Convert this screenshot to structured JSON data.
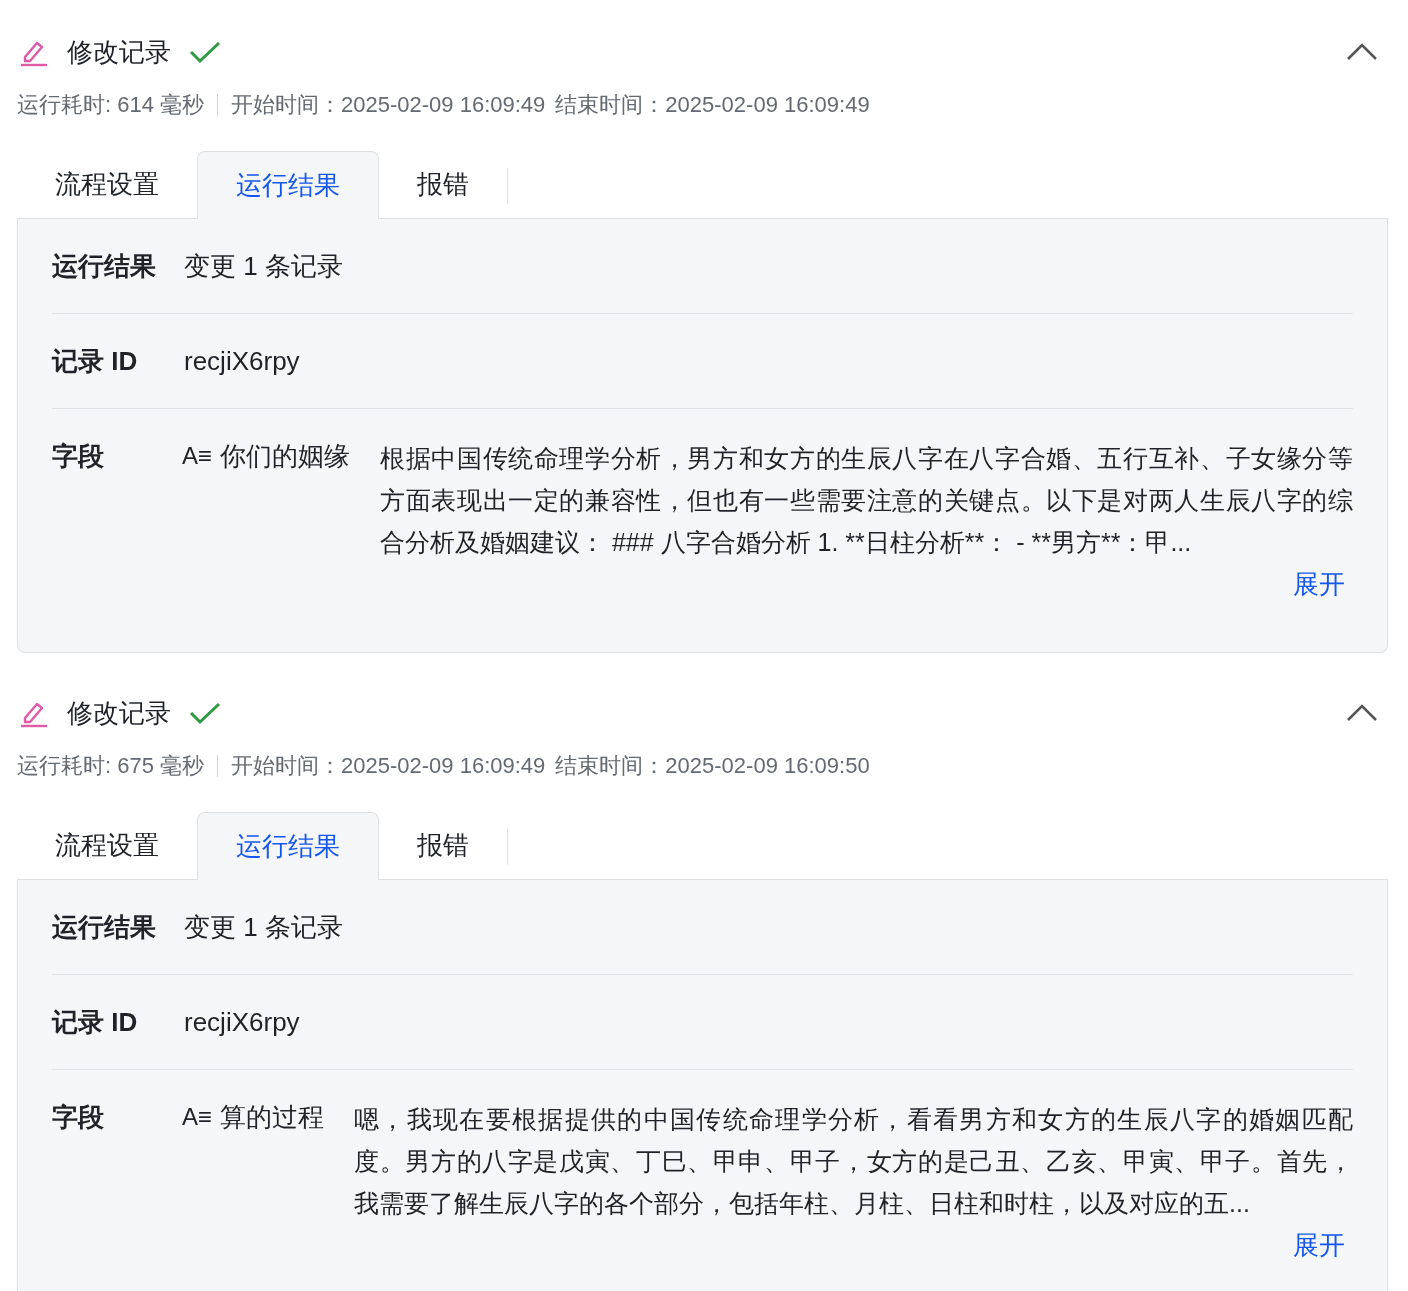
{
  "records": [
    {
      "title": "修改记录",
      "success": true,
      "expanded": true,
      "meta": {
        "duration": "运行耗时: 614 毫秒",
        "start": "开始时间：2025-02-09 16:09:49",
        "end": "结束时间：2025-02-09 16:09:49"
      },
      "tabs": [
        {
          "label": "流程设置",
          "selected": false
        },
        {
          "label": "运行结果",
          "selected": true
        },
        {
          "label": "报错",
          "selected": false
        }
      ],
      "rows": [
        {
          "kind": "text",
          "label": "运行结果",
          "value": "变更 1 条记录"
        },
        {
          "kind": "text",
          "label": "记录 ID",
          "value": "recjiX6rpy"
        },
        {
          "kind": "field",
          "label": "字段",
          "field_icon": "A≡",
          "field_name": "你们的姻缘",
          "value": "根据中国传统命理学分析，男方和女方的生辰八字在八字合婚、五行互补、子女缘分等方面表现出一定的兼容性，但也有一些需要注意的关键点。以下是对两人生辰八字的综合分析及婚姻建议： ### 八字合婚分析 1. **日柱分析**： - **男方**：甲...",
          "more": "展开"
        }
      ]
    },
    {
      "title": "修改记录",
      "success": true,
      "expanded": true,
      "meta": {
        "duration": "运行耗时: 675 毫秒",
        "start": "开始时间：2025-02-09 16:09:49",
        "end": "结束时间：2025-02-09 16:09:50"
      },
      "tabs": [
        {
          "label": "流程设置",
          "selected": false
        },
        {
          "label": "运行结果",
          "selected": true
        },
        {
          "label": "报错",
          "selected": false
        }
      ],
      "rows": [
        {
          "kind": "text",
          "label": "运行结果",
          "value": "变更 1 条记录"
        },
        {
          "kind": "text",
          "label": "记录 ID",
          "value": "recjiX6rpy"
        },
        {
          "kind": "field",
          "label": "字段",
          "field_icon": "A≡",
          "field_name": "算的过程",
          "value": "嗯，我现在要根据提供的中国传统命理学分析，看看男方和女方的生辰八字的婚姻匹配度。男方的八字是戊寅、丁巳、甲申、甲子，女方的是己丑、乙亥、甲寅、甲子。首先，我需要了解生辰八字的各个部分，包括年柱、月柱、日柱和时柱，以及对应的五...",
          "more": "展开"
        }
      ]
    }
  ]
}
